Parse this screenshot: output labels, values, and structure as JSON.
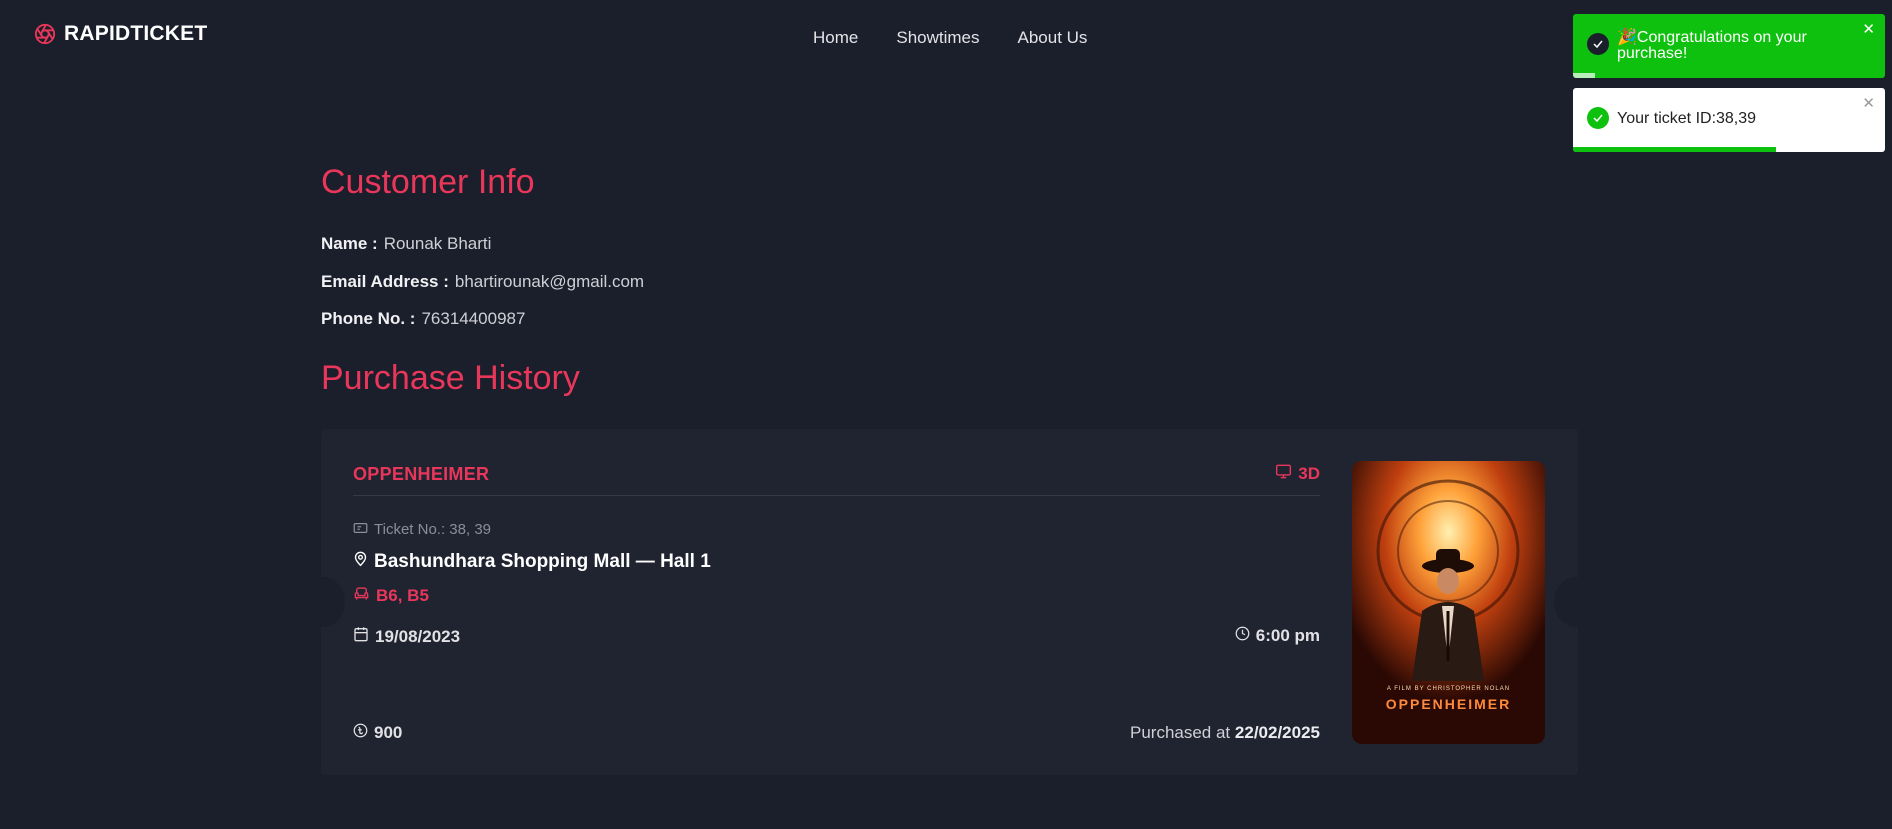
{
  "brand": {
    "name": "RAPIDTICKET",
    "accent": "#e8375a"
  },
  "nav": [
    "Home",
    "Showtimes",
    "About Us"
  ],
  "customer": {
    "title": "Customer Info",
    "name_label": "Name :",
    "name": "Rounak Bharti",
    "email_label": "Email Address :",
    "email": "bhartirounak@gmail.com",
    "phone_label": "Phone No. :",
    "phone": "76314400987"
  },
  "history": {
    "title": "Purchase History",
    "purchase": {
      "movie": "OPPENHEIMER",
      "format": "3D",
      "ticket_no": "Ticket No.: 38, 39",
      "venue": "Bashundhara Shopping Mall — Hall 1",
      "seats": "B6, B5",
      "date": "19/08/2023",
      "time": "6:00 pm",
      "price": "900",
      "purchased_label": "Purchased at",
      "purchased_date": "22/02/2025",
      "poster": {
        "title": "OPPENHEIMER",
        "credit": "A FILM BY CHRISTOPHER NOLAN"
      }
    }
  },
  "toasts": [
    {
      "type": "success",
      "text": "🎉Congratulations on your purchase!",
      "progress": 0.07
    },
    {
      "type": "info",
      "text": "Your ticket ID:38,39",
      "progress": 0.65
    }
  ],
  "icons": {
    "logo": "aperture-icon",
    "format": "monitor-icon",
    "ticket": "ticket-icon",
    "venue": "map-pin-icon",
    "seats": "armchair-icon",
    "date": "calendar-icon",
    "time": "clock-icon",
    "price": "taka-coin-icon",
    "toast_success": "check-circle-icon",
    "close": "close-icon"
  }
}
